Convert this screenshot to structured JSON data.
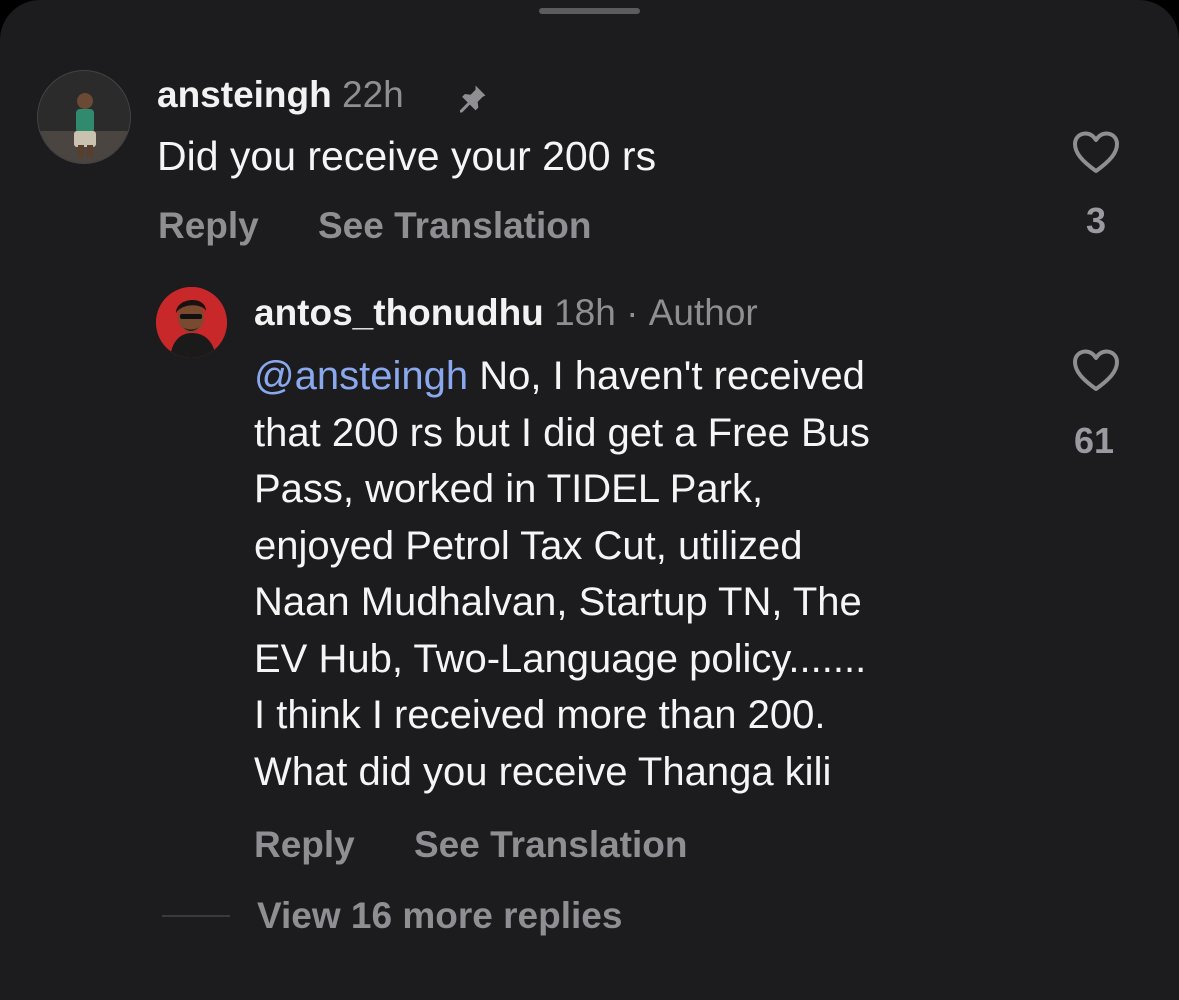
{
  "comments": [
    {
      "username": "ansteingh",
      "time": "22h",
      "pinned_icon": "pin-icon",
      "text": "Did you receive your 200 rs",
      "reply_label": "Reply",
      "translate_label": "See Translation",
      "likes": "3"
    }
  ],
  "reply": {
    "username": "antos_thonudhu",
    "time": "18h",
    "separator": "·",
    "author_badge": "Author",
    "mention": "@ansteingh",
    "lines": [
      " No, I haven't received",
      "that 200 rs but I did get a Free Bus",
      "Pass, worked in TIDEL Park,",
      "enjoyed Petrol Tax Cut, utilized",
      "Naan Mudhalvan, Startup TN, The",
      "EV Hub, Two-Language policy.......",
      "I think I received more than 200.",
      "What did you receive Thanga kili"
    ],
    "reply_label": "Reply",
    "translate_label": "See Translation",
    "likes": "61"
  },
  "view_more_label": "View 16 more replies",
  "colors": {
    "background": "#1c1c1e",
    "mention": "#8aa8ee",
    "secondary_text": "#8e8e93"
  }
}
